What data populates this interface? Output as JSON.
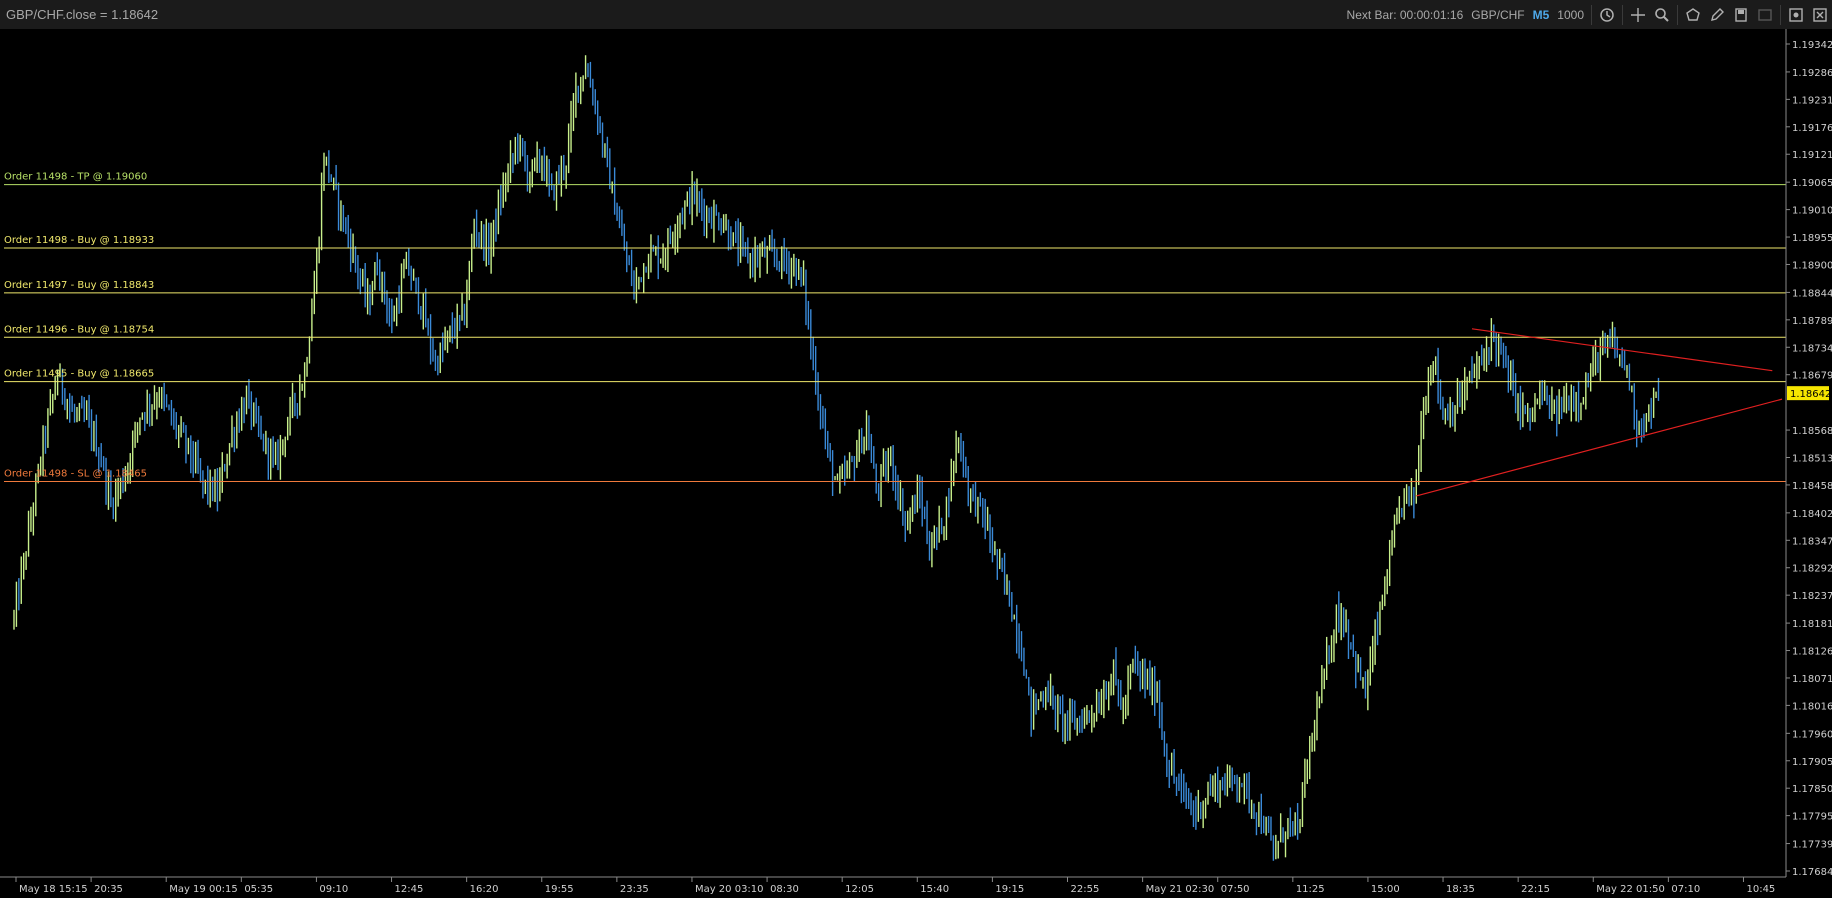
{
  "header": {
    "title": "GBP/CHF.close = 1.18642",
    "next_bar_label": "Next Bar: 00:00:01:16",
    "symbol": "GBP/CHF",
    "timeframe": "M5",
    "quantity": "1000"
  },
  "toolbar_icons": [
    "history-icon",
    "crosshair-icon",
    "zoom-icon",
    "shape-icon",
    "pencil-icon",
    "save-icon",
    "screenshot-icon",
    "settings-icon",
    "close-panel-icon"
  ],
  "colors": {
    "background": "#000000",
    "up_candle": "#c8f08c",
    "down_candle": "#3a8ad8",
    "tp_line": "#b7e067",
    "buy_line": "#f0e86c",
    "sl_line": "#f07a3c",
    "trend_line": "#e02020",
    "price_tag_bg": "#f7e600"
  },
  "chart_data": {
    "type": "candlestick",
    "symbol": "GBP/CHF",
    "timeframe": "M5",
    "last_price": "1.18642",
    "ylim": [
      1.17684,
      1.19342
    ],
    "y_ticks": [
      "1.19342",
      "1.19286",
      "1.19231",
      "1.19176",
      "1.19121",
      "1.19065",
      "1.19010",
      "1.18955",
      "1.18900",
      "1.18844",
      "1.18789",
      "1.18734",
      "1.18679",
      "1.18642",
      "1.18568",
      "1.18513",
      "1.18458",
      "1.18402",
      "1.18347",
      "1.18292",
      "1.18237",
      "1.18181",
      "1.18126",
      "1.18071",
      "1.18016",
      "1.17960",
      "1.17905",
      "1.17850",
      "1.17795",
      "1.17739",
      "1.17684"
    ],
    "x_ticks": [
      "May 18 15:15",
      "20:35",
      "May 19 00:15",
      "05:35",
      "09:10",
      "12:45",
      "16:20",
      "19:55",
      "23:35",
      "May 20 03:10",
      "08:30",
      "12:05",
      "15:40",
      "19:15",
      "22:55",
      "May 21 02:30",
      "07:50",
      "11:25",
      "15:00",
      "18:35",
      "22:15",
      "May 22 01:50",
      "07:10",
      "10:45"
    ],
    "path": [
      [
        0,
        1.1819
      ],
      [
        5,
        1.1833
      ],
      [
        12,
        1.1854
      ],
      [
        18,
        1.1868
      ],
      [
        24,
        1.186
      ],
      [
        30,
        1.1859
      ],
      [
        36,
        1.1851
      ],
      [
        40,
        1.1842
      ],
      [
        46,
        1.1848
      ],
      [
        52,
        1.186
      ],
      [
        60,
        1.1864
      ],
      [
        66,
        1.1858
      ],
      [
        72,
        1.1853
      ],
      [
        78,
        1.1846
      ],
      [
        84,
        1.1844
      ],
      [
        90,
        1.1856
      ],
      [
        96,
        1.1863
      ],
      [
        102,
        1.1855
      ],
      [
        108,
        1.185
      ],
      [
        114,
        1.186
      ],
      [
        120,
        1.1868
      ],
      [
        125,
        1.189
      ],
      [
        128,
        1.1912
      ],
      [
        134,
        1.1902
      ],
      [
        140,
        1.1892
      ],
      [
        146,
        1.1882
      ],
      [
        150,
        1.189
      ],
      [
        156,
        1.1878
      ],
      [
        162,
        1.189
      ],
      [
        168,
        1.1882
      ],
      [
        174,
        1.187
      ],
      [
        180,
        1.1876
      ],
      [
        186,
        1.188
      ],
      [
        190,
        1.1898
      ],
      [
        196,
        1.1893
      ],
      [
        202,
        1.1905
      ],
      [
        208,
        1.1915
      ],
      [
        212,
        1.1908
      ],
      [
        218,
        1.1911
      ],
      [
        222,
        1.1904
      ],
      [
        228,
        1.1911
      ],
      [
        232,
        1.1925
      ],
      [
        236,
        1.193
      ],
      [
        240,
        1.1922
      ],
      [
        244,
        1.1912
      ],
      [
        248,
        1.1902
      ],
      [
        252,
        1.1893
      ],
      [
        256,
        1.1885
      ],
      [
        262,
        1.1892
      ],
      [
        268,
        1.1892
      ],
      [
        274,
        1.1899
      ],
      [
        280,
        1.1904
      ],
      [
        286,
        1.19
      ],
      [
        292,
        1.1899
      ],
      [
        298,
        1.1894
      ],
      [
        304,
        1.1891
      ],
      [
        310,
        1.1892
      ],
      [
        316,
        1.1891
      ],
      [
        322,
        1.189
      ],
      [
        326,
        1.1886
      ],
      [
        330,
        1.187
      ],
      [
        336,
        1.1852
      ],
      [
        340,
        1.1845
      ],
      [
        346,
        1.185
      ],
      [
        352,
        1.1857
      ],
      [
        356,
        1.1845
      ],
      [
        362,
        1.1851
      ],
      [
        368,
        1.1838
      ],
      [
        374,
        1.1844
      ],
      [
        378,
        1.1833
      ],
      [
        384,
        1.1839
      ],
      [
        390,
        1.1856
      ],
      [
        394,
        1.1845
      ],
      [
        400,
        1.184
      ],
      [
        406,
        1.183
      ],
      [
        410,
        1.1825
      ],
      [
        416,
        1.1813
      ],
      [
        420,
        1.18
      ],
      [
        426,
        1.1805
      ],
      [
        432,
        1.1799
      ],
      [
        438,
        1.1798
      ],
      [
        444,
        1.18
      ],
      [
        448,
        1.1802
      ],
      [
        454,
        1.1808
      ],
      [
        458,
        1.18
      ],
      [
        462,
        1.181
      ],
      [
        466,
        1.1807
      ],
      [
        472,
        1.1804
      ],
      [
        476,
        1.179
      ],
      [
        482,
        1.1784
      ],
      [
        488,
        1.178
      ],
      [
        494,
        1.1785
      ],
      [
        500,
        1.1786
      ],
      [
        506,
        1.1787
      ],
      [
        510,
        1.1783
      ],
      [
        516,
        1.1778
      ],
      [
        520,
        1.1772
      ],
      [
        526,
        1.1778
      ],
      [
        530,
        1.1776
      ],
      [
        534,
        1.179
      ],
      [
        540,
        1.1805
      ],
      [
        546,
        1.182
      ],
      [
        550,
        1.1818
      ],
      [
        554,
        1.181
      ],
      [
        558,
        1.1804
      ],
      [
        562,
        1.1815
      ],
      [
        566,
        1.1825
      ],
      [
        570,
        1.1836
      ],
      [
        574,
        1.1844
      ],
      [
        578,
        1.1843
      ],
      [
        582,
        1.1862
      ],
      [
        586,
        1.1872
      ],
      [
        590,
        1.186
      ],
      [
        596,
        1.1862
      ],
      [
        602,
        1.1868
      ],
      [
        606,
        1.187
      ],
      [
        610,
        1.1876
      ],
      [
        614,
        1.1872
      ],
      [
        618,
        1.1866
      ],
      [
        622,
        1.1861
      ],
      [
        626,
        1.1859
      ],
      [
        630,
        1.1864
      ],
      [
        636,
        1.186
      ],
      [
        642,
        1.1863
      ],
      [
        648,
        1.1864
      ],
      [
        654,
        1.1872
      ],
      [
        660,
        1.1874
      ],
      [
        666,
        1.1869
      ],
      [
        670,
        1.1858
      ],
      [
        674,
        1.1859
      ],
      [
        679,
        1.18642
      ]
    ],
    "order_lines": [
      {
        "label": "Order 11498 - TP @ 1.19060",
        "price": 1.1906,
        "kind": "tp"
      },
      {
        "label": "Order 11498 - Buy @ 1.18933",
        "price": 1.18933,
        "kind": "buy"
      },
      {
        "label": "Order 11497 - Buy @ 1.18843",
        "price": 1.18843,
        "kind": "buy"
      },
      {
        "label": "Order 11496 - Buy @ 1.18754",
        "price": 1.18754,
        "kind": "buy"
      },
      {
        "label": "Order 11495 - Buy @ 1.18665",
        "price": 1.18665,
        "kind": "buy"
      },
      {
        "label": "Order 11498 - SL @ 1.18465",
        "price": 1.18465,
        "kind": "sl"
      }
    ],
    "trend_lines": [
      {
        "from": [
          602,
          1.18771
        ],
        "to": [
          726,
          1.18687
        ]
      },
      {
        "from": [
          579,
          1.18436
        ],
        "to": [
          730,
          1.1863
        ]
      }
    ],
    "bars_in_view": 730
  }
}
